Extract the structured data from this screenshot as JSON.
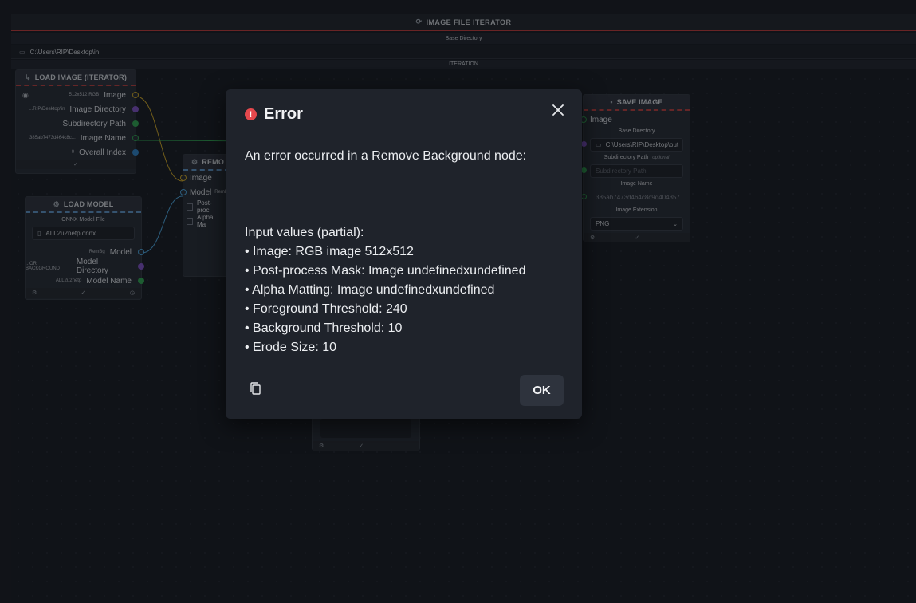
{
  "iterator": {
    "title": "IMAGE FILE ITERATOR",
    "base_directory_label": "Base Directory",
    "base_directory_value": "C:\\Users\\RIP\\Desktop\\in",
    "iteration_label": "ITERATION"
  },
  "load_image": {
    "title": "LOAD IMAGE (ITERATOR)",
    "outputs": [
      {
        "badge": "512x512 RGB",
        "label": "Image"
      },
      {
        "badge": "...RIP\\Desktop\\in",
        "label": "Image Directory"
      },
      {
        "badge": ".",
        "label": "Subdirectory Path"
      },
      {
        "badge": "385ab7473d464c8c...",
        "label": "Image Name"
      },
      {
        "badge": "0",
        "label": "Overall Index"
      }
    ]
  },
  "load_model": {
    "title": "LOAD MODEL",
    "file_label": "ONNX Model File",
    "file_value": "ALL2u2netp.onnx",
    "outputs": [
      {
        "badge": "RemBg",
        "label": "Model"
      },
      {
        "badge": "...OR BACKGROUND",
        "label": "Model Directory"
      },
      {
        "badge": "ALL2u2netp",
        "label": "Model Name"
      }
    ]
  },
  "remove_bg": {
    "title": "REMO",
    "inputs": [
      {
        "label": "Image"
      },
      {
        "label": "Model",
        "badge": "Remb"
      },
      {
        "label": "Post-proc"
      },
      {
        "label": "Alpha Ma"
      }
    ]
  },
  "save_image": {
    "title": "SAVE IMAGE",
    "input_label": "Image",
    "base_dir_label": "Base Directory",
    "base_dir_value": "C:\\Users\\RIP\\Desktop\\out",
    "subdir_label": "Subdirectory Path",
    "subdir_optional": "optional",
    "subdir_placeholder": "Subdirectory Path",
    "image_name_label": "Image Name",
    "image_name_value": "385ab7473d464c8c9d404357",
    "ext_label": "Image Extension",
    "ext_value": "PNG"
  },
  "error_dialog": {
    "title": "Error",
    "message": "An error occurred in a Remove Background node:",
    "input_values_header": "Input values (partial):",
    "input_values": [
      "• Image: RGB image 512x512",
      "• Post-process Mask: Image undefinedxundefined",
      "• Alpha Matting: Image undefinedxundefined",
      "• Foreground Threshold: 240",
      "• Background Threshold: 10",
      "• Erode Size: 10"
    ],
    "ok_label": "OK"
  },
  "colors": {
    "image_port": "#c9a227",
    "directory_port": "#7a4fbf",
    "path_port": "#2e9e4f",
    "number_port": "#2d7fc1",
    "model_port": "#4aa0d8",
    "error_red": "#e5484d"
  }
}
